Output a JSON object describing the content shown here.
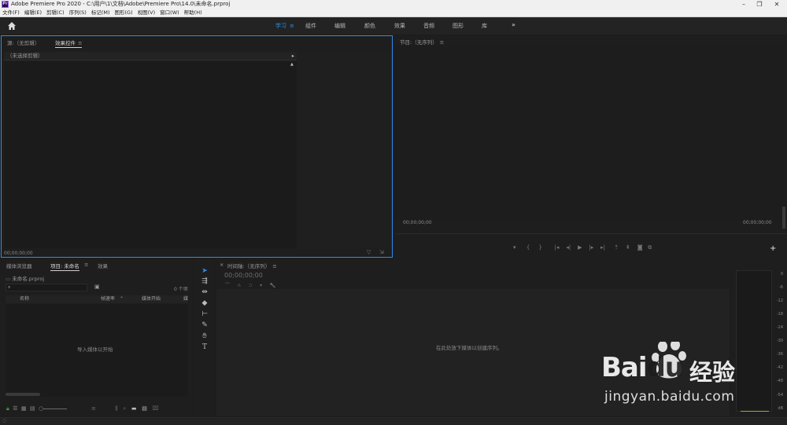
{
  "app": {
    "title": "Adobe Premiere Pro 2020 - C:\\用户\\1\\文档\\Adobe\\Premiere Pro\\14.0\\未命名.prproj",
    "logo": "Pr"
  },
  "menu": [
    "文件(F)",
    "编辑(E)",
    "剪辑(C)",
    "序列(S)",
    "标记(M)",
    "图形(G)",
    "视图(V)",
    "窗口(W)",
    "帮助(H)"
  ],
  "workspaces": [
    {
      "label": "学习",
      "active": true
    },
    {
      "label": "组件",
      "active": false
    },
    {
      "label": "编辑",
      "active": false
    },
    {
      "label": "颜色",
      "active": false
    },
    {
      "label": "效果",
      "active": false
    },
    {
      "label": "音频",
      "active": false
    },
    {
      "label": "图形",
      "active": false
    },
    {
      "label": "库",
      "active": false
    }
  ],
  "source_panel": {
    "tab_source": "源:（无剪辑）",
    "tab_effects": "效果控件",
    "no_clip": "（未选择剪辑）",
    "timecode": "00;00;00;00"
  },
  "program_panel": {
    "tab": "节目:（无序列）",
    "timecode_left": "00;00;00;00",
    "timecode_right": "00;00;00;00"
  },
  "project_panel": {
    "tab_media": "媒体浏览器",
    "tab_project": "项目: 未命名",
    "tab_effects": "效果",
    "file": "未命名.prproj",
    "item_count": "0 个项",
    "col_name": "名称",
    "col_fps": "帧速率",
    "col_start": "媒体开始",
    "col_extra": "媒",
    "empty_hint": "导入媒体以开始"
  },
  "timeline_panel": {
    "tab": "时间轴:（无序列）",
    "timecode": "00;00;00;00",
    "empty_hint": "在此处放下媒体以创建序列。"
  },
  "meter": {
    "labels": [
      "0",
      "-6",
      "-12",
      "-18",
      "-24",
      "-30",
      "-36",
      "-42",
      "-48",
      "-54",
      "dB"
    ]
  },
  "watermark": {
    "brand": "Bai",
    "brand2": "du",
    "cn": "经验",
    "url": "jingyan.baidu.com"
  }
}
